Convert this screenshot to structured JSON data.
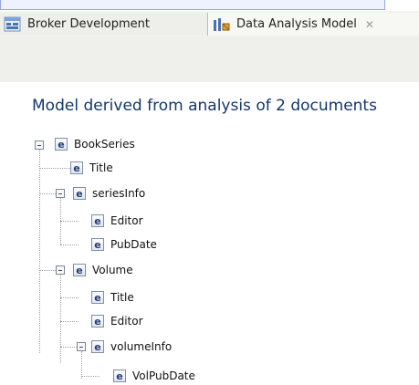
{
  "tabs": [
    {
      "label": "Broker Development",
      "icon": "broker-development-icon",
      "active": false
    },
    {
      "label": "Data Analysis Model",
      "icon": "data-analysis-model-icon",
      "active": true,
      "close_icon": "close-icon"
    }
  ],
  "model_title": "Model derived from analysis of 2 documents",
  "tree": [
    {
      "id": "bookseries",
      "label": "BookSeries",
      "icon": "element-e-icon",
      "expanded": true
    },
    {
      "id": "bookseries-title",
      "label": "Title",
      "icon": "element-e-icon"
    },
    {
      "id": "seriesinfo",
      "label": "seriesInfo",
      "icon": "element-e-icon",
      "expanded": true
    },
    {
      "id": "seriesinfo-editor",
      "label": "Editor",
      "icon": "element-e-icon"
    },
    {
      "id": "seriesinfo-pubdate",
      "label": "PubDate",
      "icon": "element-e-icon"
    },
    {
      "id": "volume",
      "label": "Volume",
      "icon": "element-e-icon",
      "expanded": true
    },
    {
      "id": "volume-title",
      "label": "Title",
      "icon": "element-e-icon"
    },
    {
      "id": "volume-editor",
      "label": "Editor",
      "icon": "element-e-icon"
    },
    {
      "id": "volumeinfo",
      "label": "volumeInfo",
      "icon": "element-e-icon",
      "expanded": true
    },
    {
      "id": "volpubdate",
      "label": "VolPubDate",
      "icon": "element-e-icon"
    }
  ],
  "element_icon_letter": "e",
  "colors": {
    "title": "#12366d",
    "tab_border": "#b9b9b2",
    "top_accent": "#8ea8e6"
  }
}
